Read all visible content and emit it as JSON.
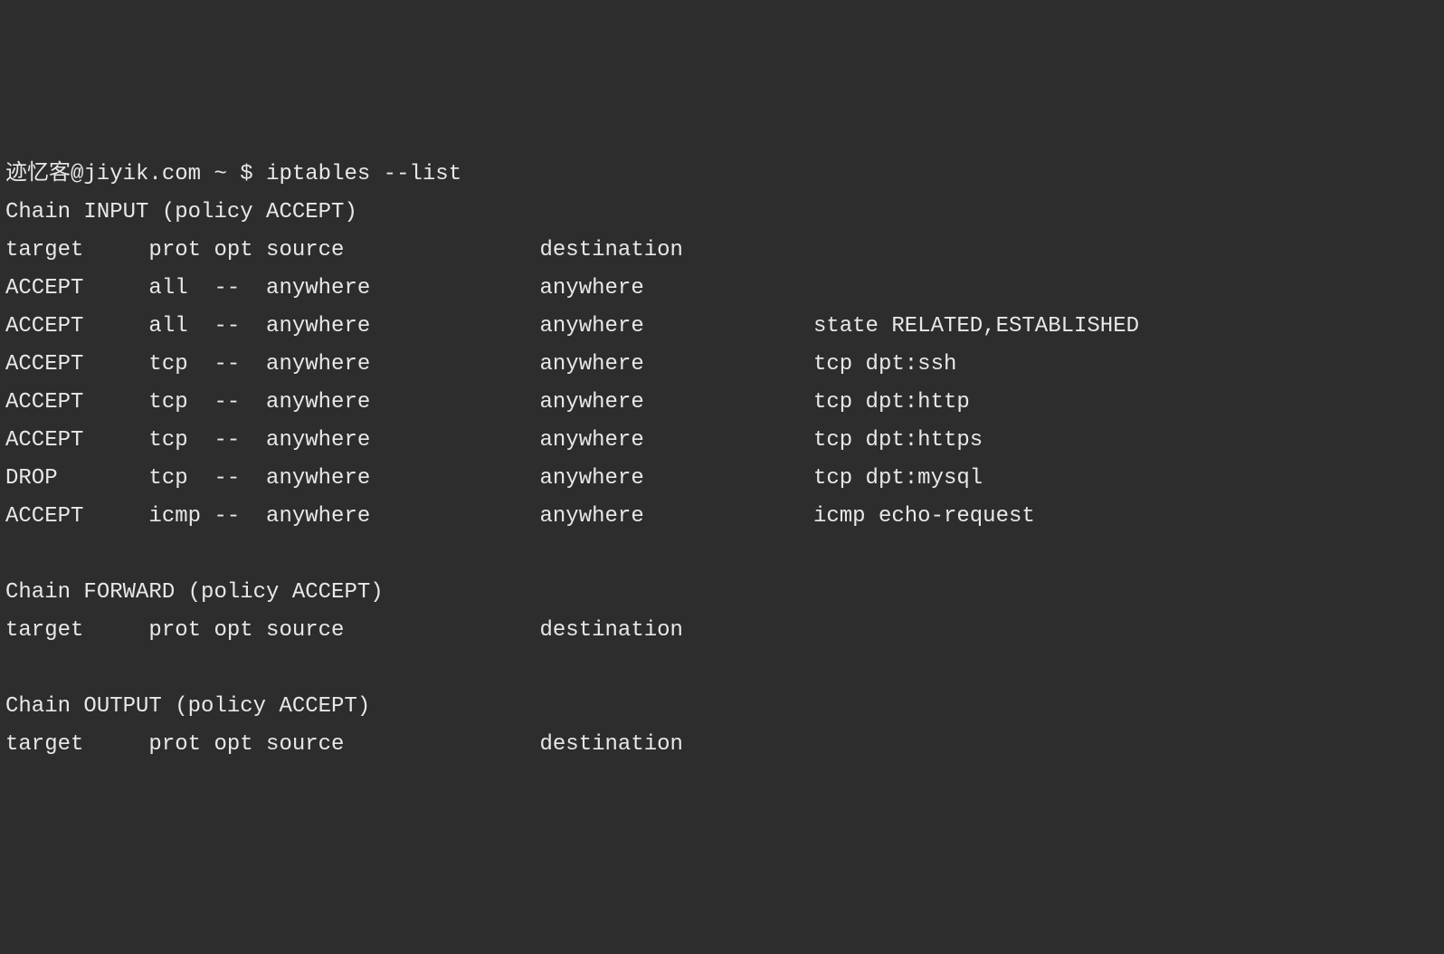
{
  "prompt": {
    "user": "迹忆客@jiyik.com",
    "path": "~",
    "symbol": "$",
    "command": "iptables --list"
  },
  "chains": [
    {
      "name": "INPUT",
      "policy": "ACCEPT",
      "header": {
        "target": "target",
        "prot": "prot",
        "opt": "opt",
        "source": "source",
        "destination": "destination"
      },
      "rules": [
        {
          "target": "ACCEPT",
          "prot": "all",
          "opt": "--",
          "source": "anywhere",
          "destination": "anywhere",
          "extra": ""
        },
        {
          "target": "ACCEPT",
          "prot": "all",
          "opt": "--",
          "source": "anywhere",
          "destination": "anywhere",
          "extra": "state RELATED,ESTABLISHED"
        },
        {
          "target": "ACCEPT",
          "prot": "tcp",
          "opt": "--",
          "source": "anywhere",
          "destination": "anywhere",
          "extra": "tcp dpt:ssh"
        },
        {
          "target": "ACCEPT",
          "prot": "tcp",
          "opt": "--",
          "source": "anywhere",
          "destination": "anywhere",
          "extra": "tcp dpt:http"
        },
        {
          "target": "ACCEPT",
          "prot": "tcp",
          "opt": "--",
          "source": "anywhere",
          "destination": "anywhere",
          "extra": "tcp dpt:https"
        },
        {
          "target": "DROP",
          "prot": "tcp",
          "opt": "--",
          "source": "anywhere",
          "destination": "anywhere",
          "extra": "tcp dpt:mysql"
        },
        {
          "target": "ACCEPT",
          "prot": "icmp",
          "opt": "--",
          "source": "anywhere",
          "destination": "anywhere",
          "extra": "icmp echo-request"
        }
      ]
    },
    {
      "name": "FORWARD",
      "policy": "ACCEPT",
      "header": {
        "target": "target",
        "prot": "prot",
        "opt": "opt",
        "source": "source",
        "destination": "destination"
      },
      "rules": []
    },
    {
      "name": "OUTPUT",
      "policy": "ACCEPT",
      "header": {
        "target": "target",
        "prot": "prot",
        "opt": "opt",
        "source": "source",
        "destination": "destination"
      },
      "rules": []
    }
  ]
}
